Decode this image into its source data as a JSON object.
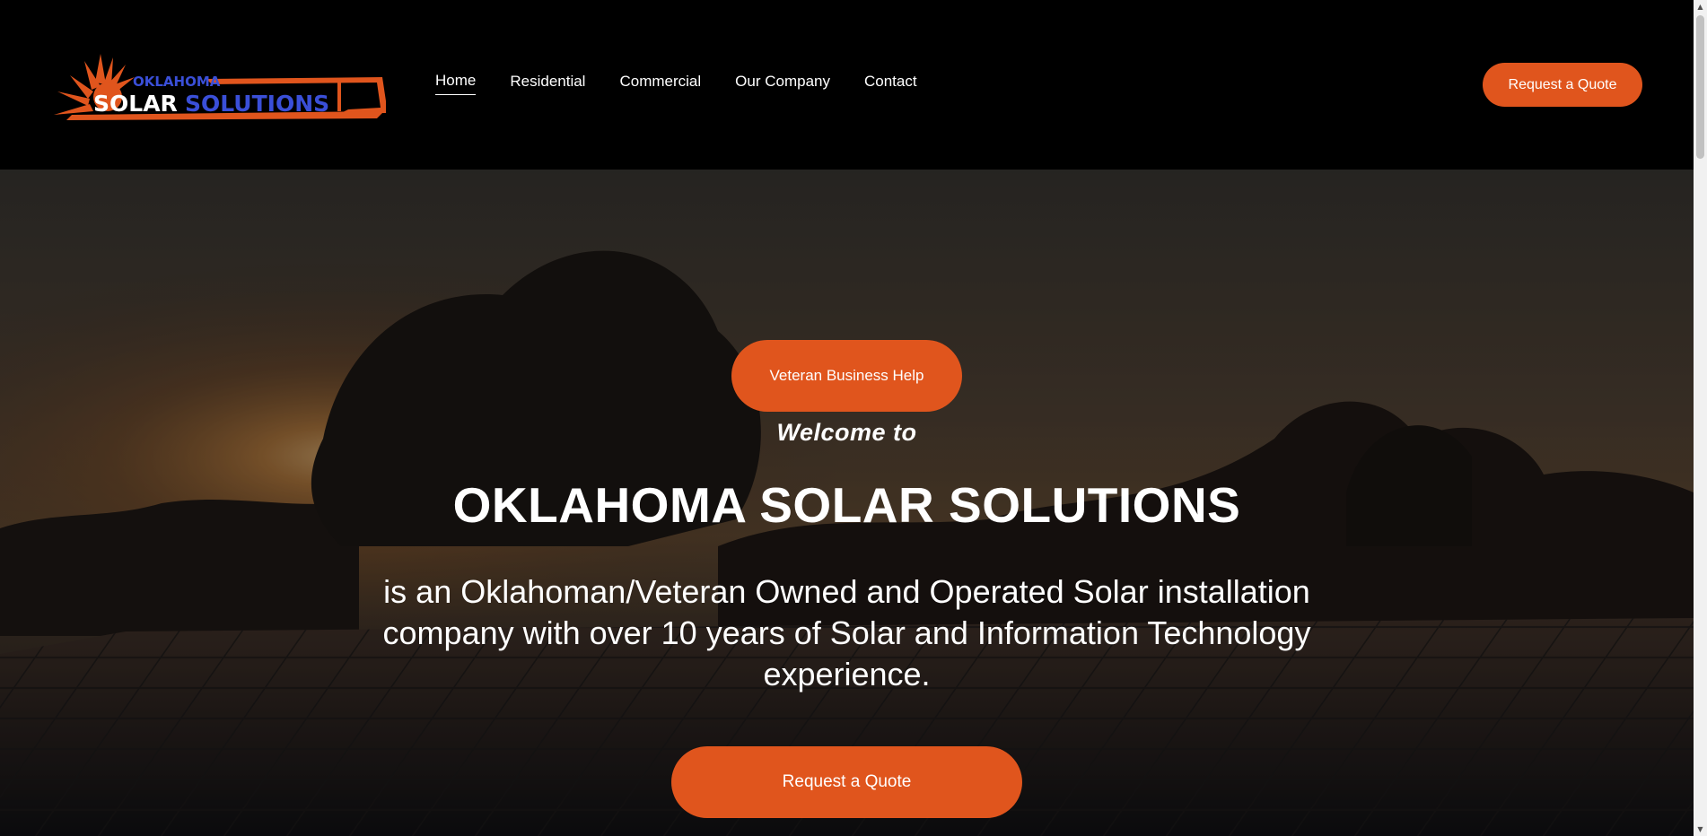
{
  "header": {
    "logo": {
      "line1": "OKLAHOMA",
      "line2a": "SOLAR",
      "line2b": "SOLUTIONS"
    },
    "nav": [
      {
        "label": "Home",
        "active": true
      },
      {
        "label": "Residential"
      },
      {
        "label": "Commercial"
      },
      {
        "label": "Our Company"
      },
      {
        "label": "Contact"
      }
    ],
    "cta_label": "Request a Quote"
  },
  "hero": {
    "pill_label": "Veteran Business Help",
    "welcome": "Welcome to",
    "title": "OKLAHOMA SOLAR SOLUTIONS",
    "subtitle": "is an Oklahoman/Veteran Owned and Operated Solar installation company with over 10 years of Solar and Information Technology experience.",
    "cta_label": "Request a Quote"
  },
  "colors": {
    "accent": "#e0551d",
    "logo_blue": "#3a4fd8",
    "header_bg": "#000000"
  },
  "icons": {
    "scroll_up": "scroll-up-arrow-icon",
    "scroll_down": "scroll-down-arrow-icon"
  }
}
